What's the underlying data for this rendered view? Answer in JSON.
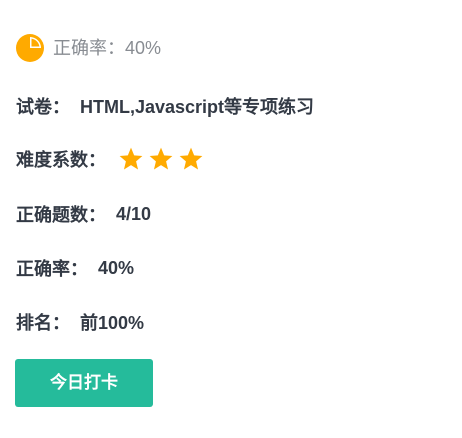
{
  "header": {
    "icon": "pie-chart-icon",
    "accuracy_text": "正确率：40%"
  },
  "paper": {
    "label": "试卷：",
    "value": "HTML,Javascript等专项练习"
  },
  "difficulty": {
    "label": "难度系数：",
    "stars": 3,
    "star_icon": "star-icon",
    "star_color": "#ffaa00"
  },
  "correct_count": {
    "label": "正确题数：",
    "value": "4/10"
  },
  "accuracy": {
    "label": "正确率：",
    "value": "40%"
  },
  "rank": {
    "label": "排名：",
    "value": "前100%"
  },
  "checkin_button": {
    "label": "今日打卡",
    "color": "#25bb9b"
  },
  "colors": {
    "icon_orange": "#ffaa00",
    "text_dark": "#333a45",
    "text_muted": "#888c92"
  }
}
